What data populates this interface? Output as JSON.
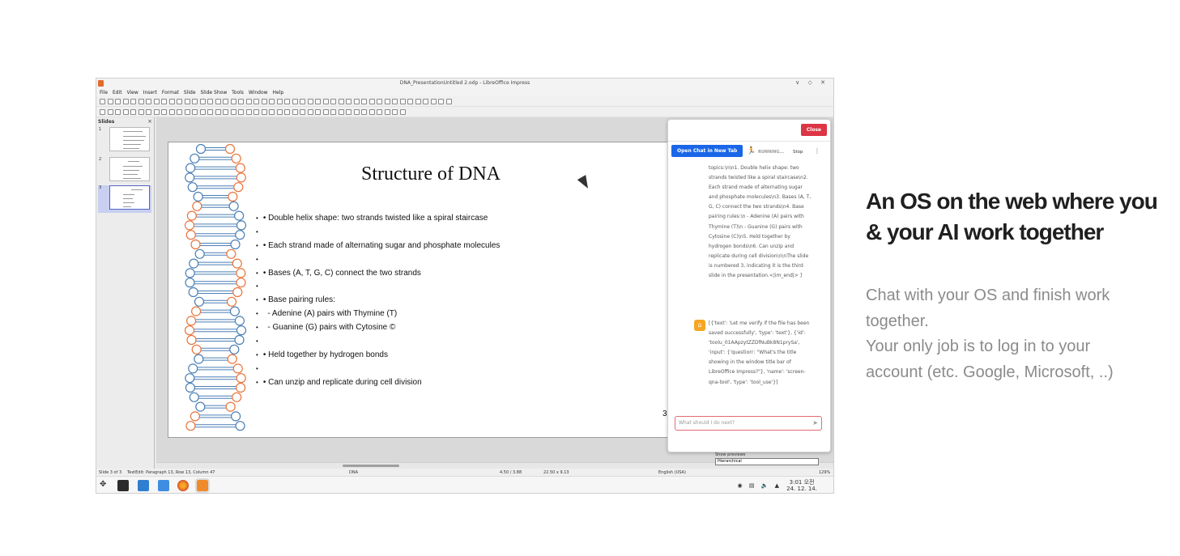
{
  "window": {
    "title": "DNA_PresentationUntitled 2.odp - LibreOffice Impress",
    "controls": "∨ ◇ ✕"
  },
  "menu": [
    "File",
    "Edit",
    "View",
    "Insert",
    "Format",
    "Slide",
    "Slide Show",
    "Tools",
    "Window",
    "Help"
  ],
  "slides_pane": {
    "title": "Slides",
    "close": "×",
    "thumbnails": [
      {
        "number": "1"
      },
      {
        "number": "2"
      },
      {
        "number": "3"
      }
    ]
  },
  "slide": {
    "title": "Structure of DNA",
    "bullets": [
      "• Double helix shape: two strands twisted like a spiral staircase",
      "",
      "• Each strand made of alternating sugar and phosphate molecules",
      "",
      "• Bases (A, T, G, C) connect the two strands",
      "",
      "• Base pairing rules:",
      "  - Adenine (A) pairs with Thymine (T)",
      "  - Guanine (G) pairs with Cytosine ©",
      "",
      "• Held together by hydrogen bonds",
      "",
      "• Can unzip and replicate during cell division"
    ],
    "number": "3"
  },
  "status_bar": {
    "slide": "Slide 3 of 3",
    "edit": "TextEdit: Paragraph 13, Row 13, Column 47",
    "layout": "DNA",
    "position": "4.50 / 3.88",
    "size": "22.50 x 9.13",
    "language": "English (USA)",
    "zoom": "129%"
  },
  "navigator": {
    "show_previews": "Show previews",
    "selected": "Hierarchical"
  },
  "ai_panel": {
    "close_label": "Close",
    "open_chat_label": "Open Chat in New Tab",
    "status": "RUNNING...",
    "stop_label": "Stop",
    "kebab": "⋮",
    "message_1": "topics:\\n\\n1. Double helix shape: two strands twisted like a spiral staircase\\n2. Each strand made of alternating sugar and phosphate molecules\\n3. Bases (A, T, G, C) connect the two strands\\n4. Base pairing rules:\\n - Adenine (A) pairs with Thymine (T)\\n - Guanine (G) pairs with Cytosine (C)\\n5. Held together by hydrogen bonds\\n6. Can unzip and replicate during cell division\\n\\nThe slide is numbered 3, indicating it is the third slide in the presentation.<|im_end|> ]",
    "message_2": "[{'text': 'Let me verify if the file has been saved successfully', 'type': 'text'}, {'id': 'toolu_01AApzytZZDfNuBk8N1prySa', 'input': {'question': \"What's the title showing in the window title bar of LibreOffice Impress?\"}, 'name': 'screen-qna-tool', 'type': 'tool_use'}]",
    "input_placeholder": "What should I do next?"
  },
  "taskbar": {
    "clock_time": "3:01 오전",
    "clock_date": "24. 12. 14."
  },
  "hero": {
    "title": "An OS on the web where you & your AI work together",
    "subtitle_1": "Chat with your OS and finish work together.",
    "subtitle_2": "Your only job is to log in to your account (etc. Google, Microsoft, ..)"
  },
  "colors": {
    "close_button": "#dc3545",
    "open_chat_button": "#1a66e8",
    "dna_blue": "#4a7fb5",
    "dna_orange": "#e8743b"
  }
}
